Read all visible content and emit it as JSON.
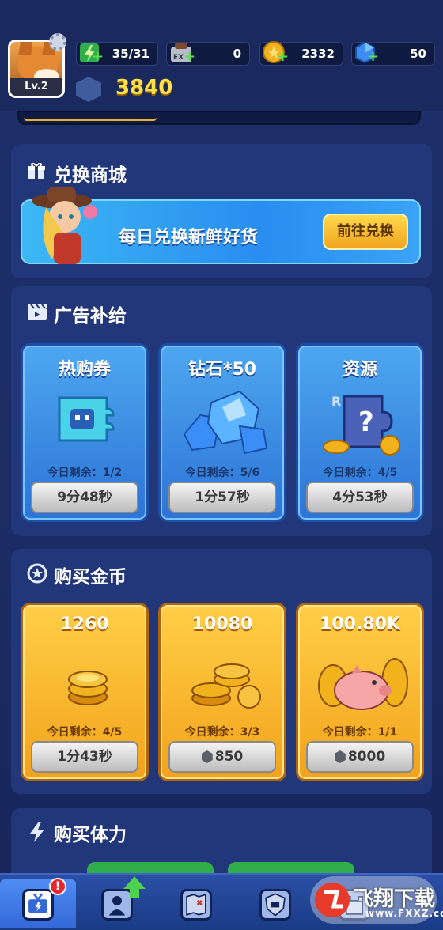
{
  "top": {
    "level": "Lv.2",
    "stamina": "35/31",
    "exp_item": "0",
    "exp_icon_label": "EX",
    "coins": "2332",
    "gems": "50",
    "power": "3840"
  },
  "exchange": {
    "title": "兑换商城",
    "banner_text": "每日兑换新鲜好货",
    "button": "前往兑换"
  },
  "ads": {
    "title": "广告补给",
    "cards": [
      {
        "title": "热购券",
        "remain": "今日剩余：1/2",
        "timer": "9分48秒"
      },
      {
        "title": "钻石*50",
        "remain": "今日剩余：5/6",
        "timer": "1分57秒"
      },
      {
        "title": "资源",
        "remain": "今日剩余：4/5",
        "timer": "4分53秒"
      }
    ]
  },
  "gold": {
    "title": "购买金币",
    "cards": [
      {
        "amount": "1260",
        "remain": "今日剩余：4/5",
        "price": "1分43秒"
      },
      {
        "amount": "10080",
        "remain": "今日剩余：3/3",
        "price": "850"
      },
      {
        "amount": "100.80K",
        "remain": "今日剩余：1/1",
        "price": "8000"
      }
    ]
  },
  "stamina": {
    "title": "购买体力"
  },
  "nav": {
    "badge": "!"
  },
  "watermark": {
    "text": "飞翔下载",
    "url": "www.FXXZ.com"
  },
  "colors": {
    "accent_gold": "#ffe14a",
    "card_blue": "#2c74d6",
    "card_gold": "#f3a21c"
  }
}
